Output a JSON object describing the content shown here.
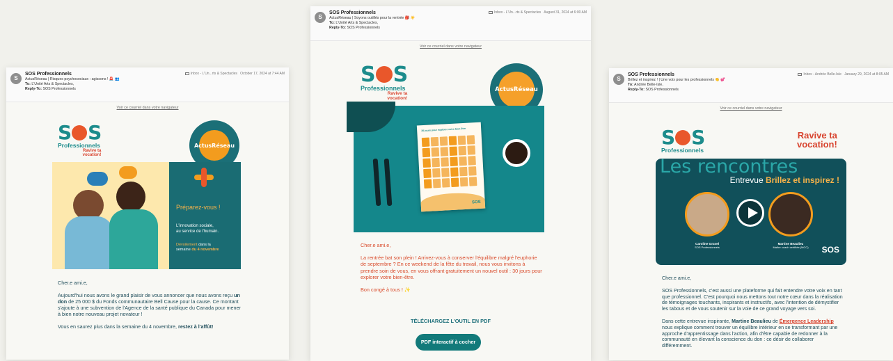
{
  "colors": {
    "teal": "#1d8c8c",
    "dark_teal": "#1b6f77",
    "orange": "#f39c1e",
    "red": "#e9572b",
    "cream": "#fdf3dc"
  },
  "email1": {
    "avatar": "S",
    "from": "SOS Professionnels",
    "subject": "ActusRéseau | Risques psychosociaux : agissons ! 🚨 👥",
    "to_label": "To:",
    "to": "L'Unité Arts & Spectacles,",
    "reply_label": "Reply-To:",
    "reply_to": "SOS Professionnels",
    "mailbox": "Inbox - L'Un...rts & Spectacles",
    "date": "October 17, 2024 at 7:44 AM",
    "view_link": "Voir ce courriel dans votre navigateur",
    "logo_sos_a": "S",
    "logo_sos_b": "S",
    "logo_pro": "Professionnels",
    "logo_rav_1": "Ravive ta",
    "logo_rav_2": "vocation!",
    "badge": "ActusRéseau",
    "panel_title": "Préparez-vous !",
    "panel_line1": "L'innovation sociale,",
    "panel_line2": "au service de l'humain.",
    "panel_reveal_1": "Dévoilement",
    "panel_reveal_2": " dans la",
    "panel_reveal_3": "semaine ",
    "panel_reveal_4": "du 4 novembre",
    "greeting": "Cher.e ami.e,",
    "p1_a": "Aujourd'hui nous avons le grand plaisir de vous annoncer que nous avons reçu ",
    "p1_b": "un don",
    "p1_c": " de 25 000 $ du Fonds communautaire Bell Cause pour la cause. Ce montant s'ajoute à une subvention de l'Agence de la santé publique du Canada pour mener à bien notre nouveau projet novateur !",
    "p2_a": "Vous en saurez plus dans la semaine du 4 novembre, ",
    "p2_b": "restez à l'affût!"
  },
  "email2": {
    "avatar": "S",
    "from": "SOS Professionnels",
    "subject": "ActusRéseau | Soyons outillés pour la rentrée 🎒 ☀️",
    "to_label": "To:",
    "to": "L'Unité Arts & Spectacles,",
    "reply_label": "Reply-To:",
    "reply_to": "SOS Professionnels",
    "mailbox": "Inbox - L'Un...rts & Spectacles",
    "date": "August 31, 2024 at 6:00 AM",
    "view_link": "Voir ce courriel dans votre navigateur",
    "logo_sos_a": "S",
    "logo_sos_b": "S",
    "logo_pro": "Professionnels",
    "logo_rav_1": "Ravive ta",
    "logo_rav_2": "vocation!",
    "badge": "ActusRéseau",
    "doc_title": "30 jours pour explorer votre bien-être",
    "doc_logo": "SOS",
    "greeting": "Cher.e ami.e,",
    "p1": "La rentrée bat son plein ! Arrivez-vous à conserver l'équilibre malgré l'euphorie de septembre ? En ce weekend de la fête du travail, nous vous invitons à prendre soin de vous, en vous offrant gratuitement un nouvel outil : 30 jours pour explorer votre bien-être.",
    "p2": "Bon congé à tous ! ✨",
    "download": "TÉLÉCHARGEZ L'OUTIL EN PDF",
    "button": "PDF interactif à cocher"
  },
  "email3": {
    "avatar": "S",
    "from": "SOS Professionnels",
    "subject": "Brillez et inspirez ! | Une voix pour les professionnels 👏 💕",
    "to_label": "To:",
    "to": "Andrée Belle-Isle,",
    "reply_label": "Reply-To:",
    "reply_to": "SOS Professionnels",
    "mailbox": "Inbox - Andrée Belle-Isle",
    "date": "January 29, 2024 at 8:05 AM",
    "view_link": "Voir ce courriel dans votre navigateur",
    "logo_sos_a": "S",
    "logo_sos_b": "S",
    "logo_pro": "Professionnels",
    "logo_rav_1": "Ravive ta",
    "logo_rav_2": "vocation!",
    "video_title": "Les rencontres",
    "video_sub_a": "Entrevue ",
    "video_sub_b": "Brillez et inspirez !",
    "person1_name": "Caroline Gravel",
    "person1_role": "SOS Professionnels",
    "person2_name": "Martine Beaulieu",
    "person2_role": "Maître coach certifiée (MCC)",
    "video_logo": "SOS",
    "greeting": "Cher.e ami.e,",
    "p1": "SOS Professionnels, c'est aussi une plateforme qui fait entendre votre voix en tant que professionnel. C'est pourquoi nous mettons tout notre cœur dans la réalisation de témoignages touchants, inspirants et instructifs, avec l'intention de démystifier les tabous et de vous soutenir sur la voie de ce grand voyage vers soi.",
    "p2_a": "Dans cette entrevue inspirante, ",
    "p2_b": "Martine Beaulieu",
    "p2_c": " de ",
    "p2_d": "Émergence Leadership",
    "p2_e": " nous explique comment trouver un équilibre intérieur en se transformant par une approche d'apprentissage dans l'action, afin d'être capable de redonner à la communauté en élevant la conscience du don : ce désir de collaborer différemment."
  }
}
